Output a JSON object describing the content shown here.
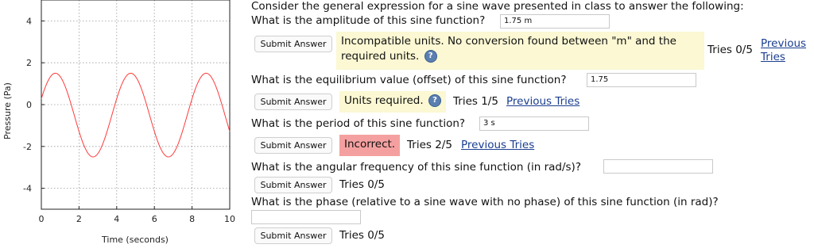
{
  "chart_data": {
    "type": "line",
    "xlabel": "Time (seconds)",
    "ylabel": "Pressure (Pa)",
    "xlim": [
      0,
      10
    ],
    "ylim": [
      -5,
      5
    ],
    "xticks": [
      0,
      2,
      4,
      6,
      8,
      10
    ],
    "yticks": [
      -4,
      -2,
      0,
      2,
      4
    ],
    "grid": true,
    "series": [
      {
        "color": "#ff3b3b",
        "amplitude": 2,
        "offset": -0.5,
        "period": 4,
        "phase": 0.4
      }
    ]
  },
  "intro": "Consider the general expression for a sine wave presented in class to answer the following:",
  "questions": [
    {
      "text": "What is the amplitude of this sine function?",
      "answer": "1.75 m",
      "button": "Submit Answer",
      "feedback": "Incompatible units. No conversion found between \"m\" and the required units.",
      "help_icon": "?",
      "tries": "Tries 0/5",
      "previous": "Previous Tries"
    },
    {
      "text": "What is the equilibrium value (offset) of this sine function?",
      "answer": "1.75",
      "button": "Submit Answer",
      "feedback": "Units required.",
      "help_icon": "?",
      "tries": "Tries 1/5",
      "previous": "Previous Tries"
    },
    {
      "text": "What is the period of this sine function?",
      "answer": "3 s",
      "button": "Submit Answer",
      "feedback": "Incorrect.",
      "tries": "Tries 2/5",
      "previous": "Previous Tries"
    },
    {
      "text": "What is the angular frequency of this sine function (in rad/s)?",
      "answer": "",
      "button": "Submit Answer",
      "tries": "Tries 0/5"
    },
    {
      "text": "What is the phase (relative to a sine wave with no phase) of this sine function (in rad)?",
      "answer": "",
      "button": "Submit Answer",
      "tries": "Tries 0/5"
    }
  ]
}
